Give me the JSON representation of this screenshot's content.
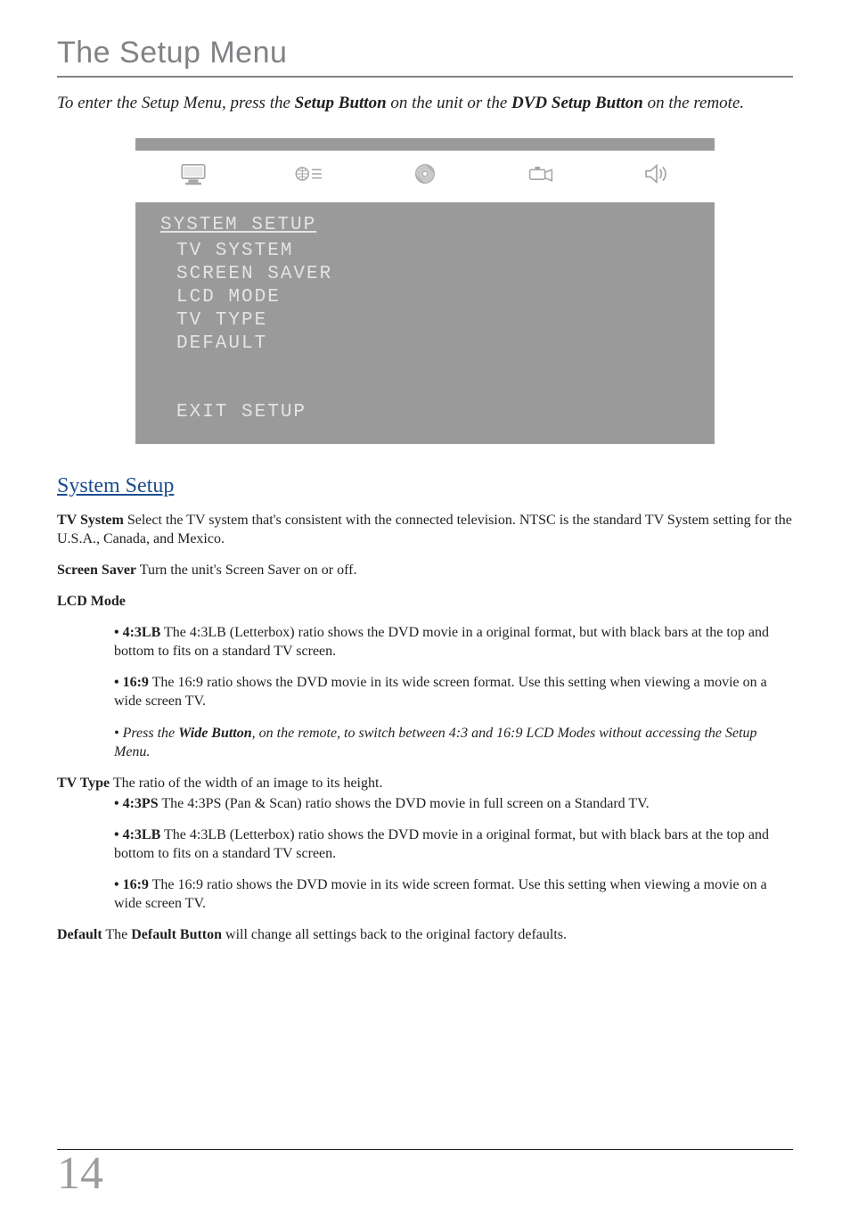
{
  "title": "The Setup Menu",
  "intro": {
    "t1": "To enter the Setup Menu, press the ",
    "b1": "Setup Button",
    "t2": " on the unit or the ",
    "b2": "DVD Setup Button",
    "t3": " on the remote."
  },
  "menu": {
    "section_title": "SYSTEM SETUP",
    "items": [
      "TV SYSTEM",
      "SCREEN SAVER",
      "LCD MODE",
      "TV TYPE",
      "DEFAULT"
    ],
    "exit": "EXIT SETUP"
  },
  "section_head": "System Setup",
  "tv_system": {
    "label": "TV System",
    "text": " Select the TV system that's consistent with the connected television.  NTSC is the standard TV System setting for the U.S.A., Canada, and Mexico."
  },
  "screen_saver": {
    "label": "Screen Saver",
    "text": " Turn the unit's Screen Saver on or off."
  },
  "lcd_mode": {
    "label": "LCD Mode",
    "r43lb": {
      "b": "• 4:3LB",
      "t": " The 4:3LB (Letterbox) ratio shows the DVD movie in a original format, but with black bars at the top and bottom to fits on a standard TV screen."
    },
    "r169": {
      "b": "• 16:9",
      "t": " The 16:9 ratio shows the DVD movie in its wide screen format.  Use this setting when viewing a movie on a wide screen TV."
    },
    "note": {
      "t1": "• Press the ",
      "b": "Wide Button",
      "t2": ", on the remote, to switch between 4:3 and 16:9 LCD Modes without accessing the Setup Menu."
    }
  },
  "tv_type": {
    "label": "TV Type",
    "desc": "  The ratio of the width of an image to its height.",
    "r43ps": {
      "b": "• 4:3PS",
      "t": " The 4:3PS (Pan & Scan) ratio shows the DVD movie in full screen on a Standard TV."
    },
    "r43lb": {
      "b": "• 4:3LB",
      "t": " The 4:3LB (Letterbox) ratio shows the DVD movie in a original format, but with black bars at the top and bottom to fits on a standard TV screen."
    },
    "r169": {
      "b": "• 16:9",
      "t": " The 16:9 ratio shows the DVD movie in its wide screen format.  Use this setting when viewing a movie on a wide screen TV."
    }
  },
  "default_line": {
    "l1": "Default",
    "t1": " The ",
    "l2": "Default Button",
    "t2": " will change all settings back to the original factory defaults."
  },
  "page_number": "14"
}
